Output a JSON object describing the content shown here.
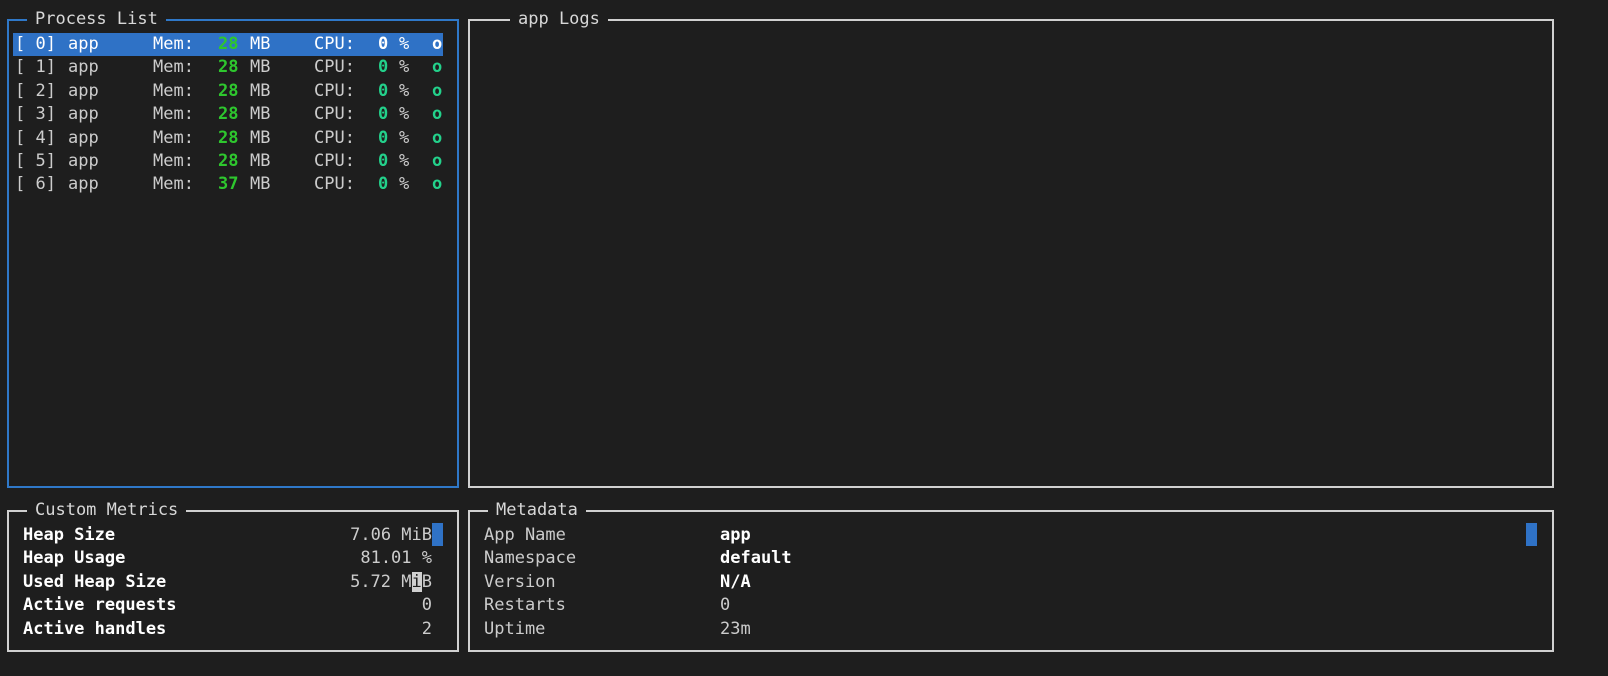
{
  "process_list": {
    "title": "Process List",
    "mem_label": "Mem:",
    "cpu_label": "CPU:",
    "mem_unit": "MB",
    "cpu_unit": "%",
    "status_glyph": "o",
    "rows": [
      {
        "id": "[ 0]",
        "name": "app",
        "mem": "28",
        "cpu": "0",
        "selected": true
      },
      {
        "id": "[ 1]",
        "name": "app",
        "mem": "28",
        "cpu": "0",
        "selected": false
      },
      {
        "id": "[ 2]",
        "name": "app",
        "mem": "28",
        "cpu": "0",
        "selected": false
      },
      {
        "id": "[ 3]",
        "name": "app",
        "mem": "28",
        "cpu": "0",
        "selected": false
      },
      {
        "id": "[ 4]",
        "name": "app",
        "mem": "28",
        "cpu": "0",
        "selected": false
      },
      {
        "id": "[ 5]",
        "name": "app",
        "mem": "28",
        "cpu": "0",
        "selected": false
      },
      {
        "id": "[ 6]",
        "name": "app",
        "mem": "37",
        "cpu": "0",
        "selected": false
      }
    ]
  },
  "logs": {
    "title": "app Logs"
  },
  "custom_metrics": {
    "title": "Custom Metrics",
    "items": [
      {
        "label": "Heap Size",
        "value": "7.06 MiB"
      },
      {
        "label": "Heap Usage",
        "value": "81.01 %"
      },
      {
        "label": "Used Heap Size",
        "value_prefix": "5.72 M",
        "value_cursor": "i",
        "value_suffix": "B"
      },
      {
        "label": "Active requests",
        "value": "0"
      },
      {
        "label": "Active handles",
        "value": "2"
      }
    ]
  },
  "metadata": {
    "title": "Metadata",
    "items": [
      {
        "label": "App Name",
        "value": "app",
        "bold": true
      },
      {
        "label": "Namespace",
        "value": "default",
        "bold": true
      },
      {
        "label": "Version",
        "value": "N/A",
        "bold": true
      },
      {
        "label": "Restarts",
        "value": "0",
        "bold": false
      },
      {
        "label": "Uptime",
        "value": "23m",
        "bold": false
      }
    ]
  },
  "colors": {
    "background": "#1e1e1e",
    "border": "#d0d0d0",
    "focus_border": "#2f78c8",
    "selection": "#2f72c6",
    "value_green": "#23d18b",
    "mem_green": "#2ec72e"
  }
}
